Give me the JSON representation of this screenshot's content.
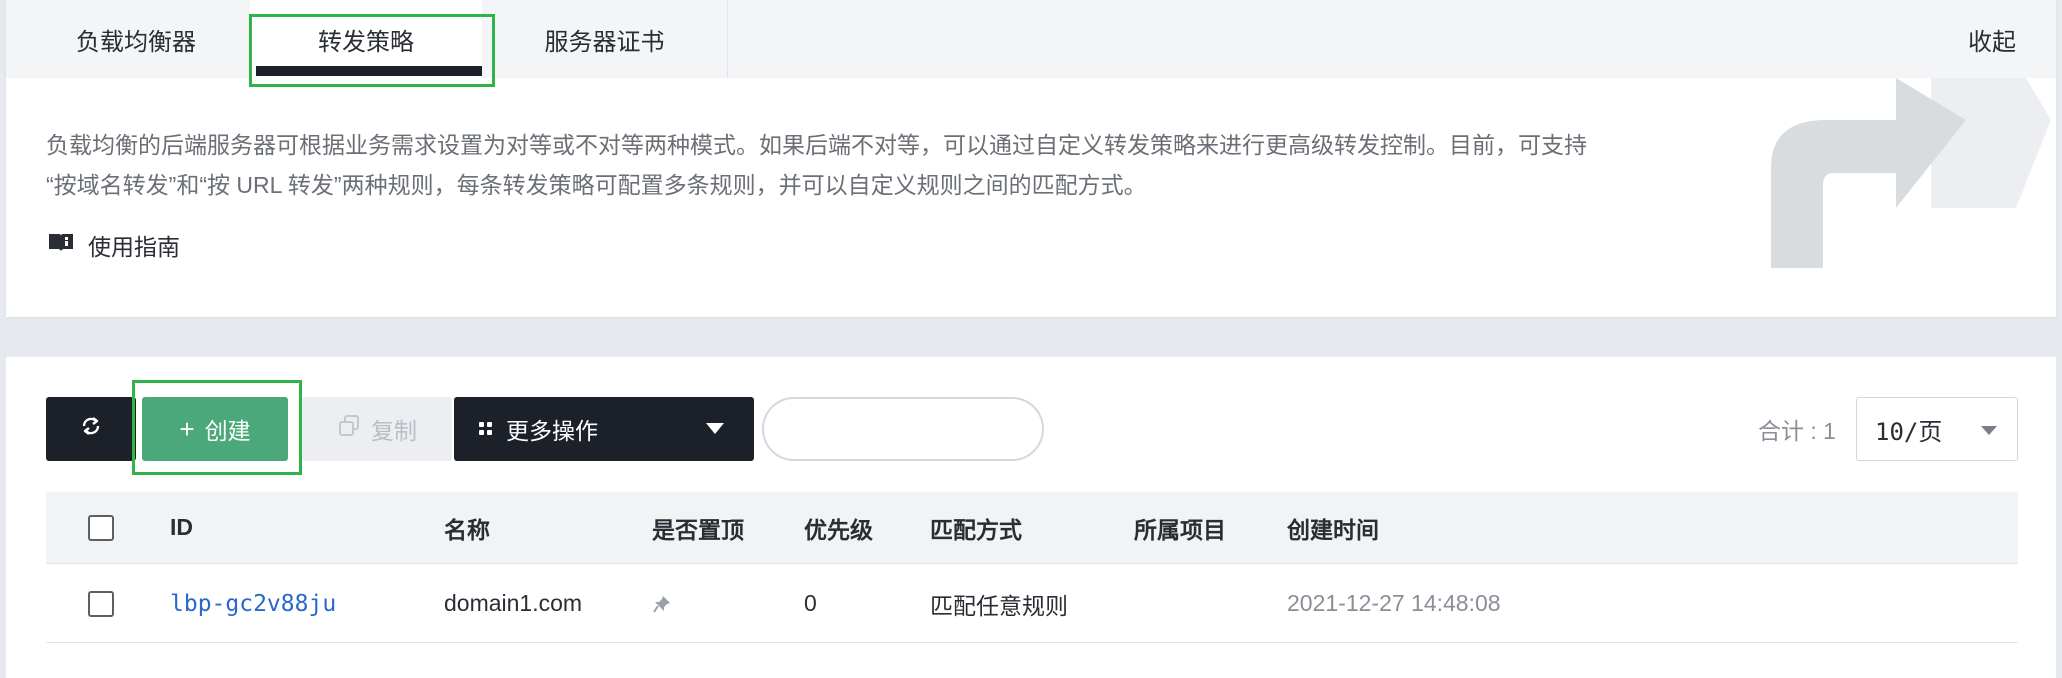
{
  "tabs": [
    {
      "label": "负载均衡器"
    },
    {
      "label": "转发策略"
    },
    {
      "label": "服务器证书"
    }
  ],
  "collapse_label": "收起",
  "description": {
    "line1": "负载均衡的后端服务器可根据业务需求设置为对等或不对等两种模式。如果后端不对等，可以通过自定义转发策略来进行更高级转发控制。目前，可支持",
    "line2": "“按域名转发”和“按 URL 转发”两种规则，每条转发策略可配置多条规则，并可以自定义规则之间的匹配方式。"
  },
  "guide_label": "使用指南",
  "toolbar": {
    "create_label": "创建",
    "copy_label": "复制",
    "more_label": "更多操作",
    "search_value": "",
    "total_label": "合计 : 1",
    "page_size": "10/页"
  },
  "table": {
    "headers": {
      "id": "ID",
      "name": "名称",
      "pinned": "是否置顶",
      "priority": "优先级",
      "match": "匹配方式",
      "project": "所属项目",
      "created": "创建时间"
    },
    "rows": [
      {
        "id": "lbp-gc2v88ju",
        "name": "domain1.com",
        "pinned_icon": "pin-icon",
        "priority": "0",
        "match": "匹配任意规则",
        "project": "",
        "created": "2021-12-27 14:48:08"
      }
    ]
  },
  "colors": {
    "highlight": "#2fb34a",
    "create_button": "#4aa87a",
    "dark_button": "#1b2029",
    "link": "#2a68c9"
  }
}
